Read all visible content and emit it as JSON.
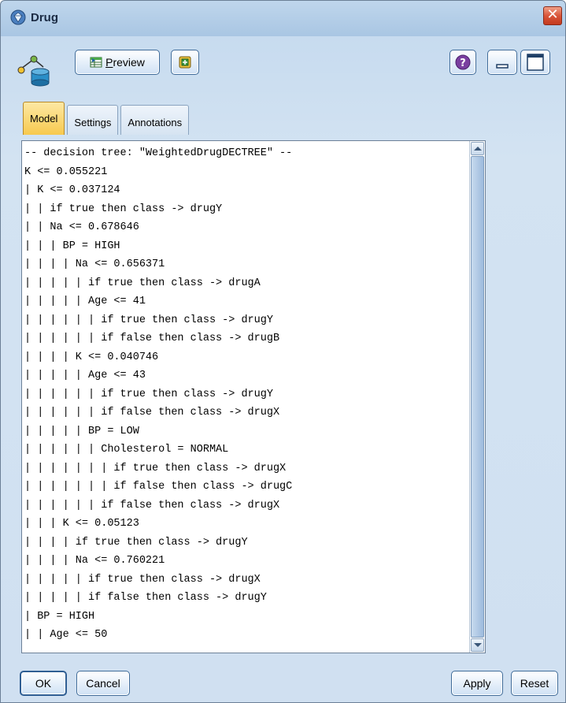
{
  "window": {
    "title": "Drug",
    "icons": {
      "title": "diamond-gem-icon",
      "close": "close-x-icon",
      "node": "tree-model-node-icon"
    }
  },
  "toolbar": {
    "preview_label": "Preview",
    "preview_icon": "preview-table-icon",
    "generate_icon": "generate-node-icon",
    "help_icon": "help-question-icon",
    "minimize_icon": "minimize-icon",
    "maximize_icon": "maximize-icon"
  },
  "tabs": [
    {
      "label": "Model",
      "active": true
    },
    {
      "label": "Settings",
      "active": false
    },
    {
      "label": "Annotations",
      "active": false
    }
  ],
  "model_text": [
    "-- decision tree: \"WeightedDrugDECTREE\" --",
    "K <= 0.055221",
    "| K <= 0.037124",
    "| | if true then class -> drugY",
    "| | Na <= 0.678646",
    "| | | BP = HIGH",
    "| | | | Na <= 0.656371",
    "| | | | | if true then class -> drugA",
    "| | | | | Age <= 41",
    "| | | | | | if true then class -> drugY",
    "| | | | | | if false then class -> drugB",
    "| | | | K <= 0.040746",
    "| | | | | Age <= 43",
    "| | | | | | if true then class -> drugY",
    "| | | | | | if false then class -> drugX",
    "| | | | | BP = LOW",
    "| | | | | | Cholesterol = NORMAL",
    "| | | | | | | if true then class -> drugX",
    "| | | | | | | if false then class -> drugC",
    "| | | | | | if false then class -> drugX",
    "| | | K <= 0.05123",
    "| | | | if true then class -> drugY",
    "| | | | Na <= 0.760221",
    "| | | | | if true then class -> drugX",
    "| | | | | if false then class -> drugY",
    "| BP = HIGH",
    "| | Age <= 50"
  ],
  "buttons": {
    "ok": "OK",
    "cancel": "Cancel",
    "apply": "Apply",
    "reset": "Reset"
  },
  "colors": {
    "window_bg": "#d0e0f1",
    "active_tab": "#f7c94e",
    "close_button": "#d9553a",
    "scroll_thumb": "#9dbbdd"
  }
}
